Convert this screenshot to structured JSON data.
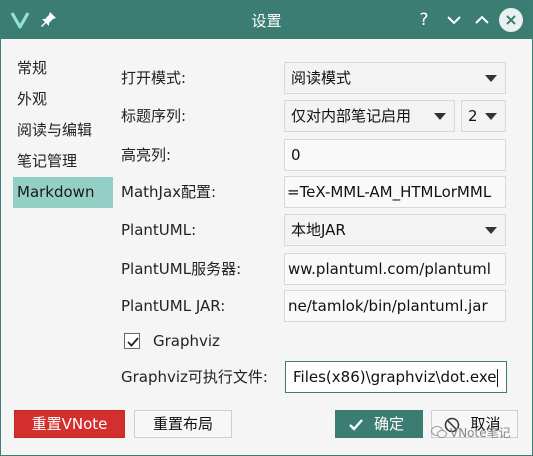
{
  "window": {
    "title": "设置"
  },
  "sidebar": {
    "items": [
      {
        "label": "常规"
      },
      {
        "label": "外观"
      },
      {
        "label": "阅读与编辑"
      },
      {
        "label": "笔记管理"
      },
      {
        "label": "Markdown",
        "active": true
      }
    ]
  },
  "form": {
    "open_mode": {
      "label": "打开模式:",
      "value": "阅读模式"
    },
    "heading_seq": {
      "label": "标题序列:",
      "value": "仅对内部笔记启用",
      "level": "2"
    },
    "highlight_col": {
      "label": "高亮列:",
      "value": "0"
    },
    "mathjax": {
      "label": "MathJax配置:",
      "value": "=TeX-MML-AM_HTMLorMML"
    },
    "plantuml": {
      "label": "PlantUML:",
      "value": "本地JAR"
    },
    "plantuml_server": {
      "label": "PlantUML服务器:",
      "value": "ww.plantuml.com/plantuml"
    },
    "plantuml_jar": {
      "label": "PlantUML JAR:",
      "value": "ne/tamlok/bin/plantuml.jar"
    },
    "graphviz": {
      "label": "Graphviz",
      "checked": true
    },
    "graphviz_exe": {
      "label": "Graphviz可执行文件:",
      "value": "Files(x86)\\graphviz\\dot.exe"
    }
  },
  "buttons": {
    "reset_vnote": "重置VNote",
    "reset_layout": "重置布局",
    "ok": "确定",
    "cancel": "取消"
  },
  "watermark": "VNote笔记",
  "colors": {
    "titlebar": "#3b7d72",
    "accent": "#94cfc6",
    "danger": "#d32f2f"
  }
}
